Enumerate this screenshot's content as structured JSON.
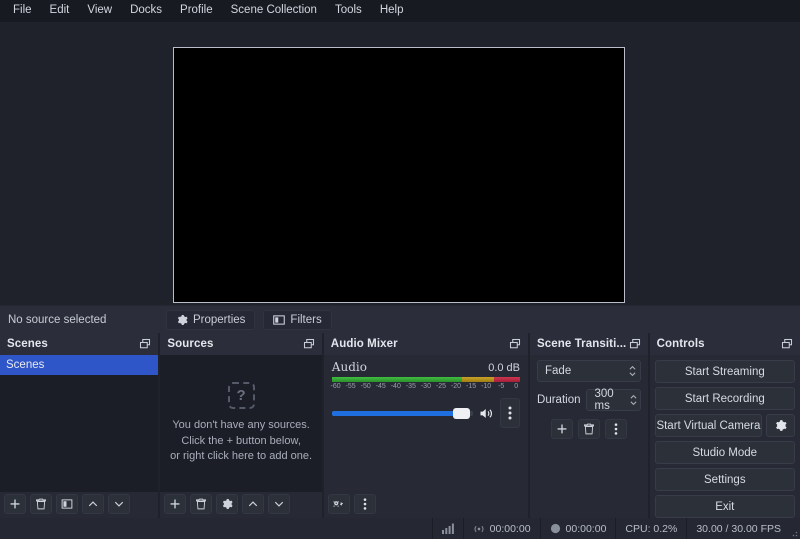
{
  "menu": {
    "items": [
      {
        "label": "File"
      },
      {
        "label": "Edit"
      },
      {
        "label": "View"
      },
      {
        "label": "Docks"
      },
      {
        "label": "Profile"
      },
      {
        "label": "Scene Collection"
      },
      {
        "label": "Tools"
      },
      {
        "label": "Help"
      }
    ]
  },
  "preview": {
    "canvas_color": "#000000",
    "border_color": "#b9bcc9"
  },
  "source_bar": {
    "no_source_label": "No source selected",
    "properties_label": "Properties",
    "filters_label": "Filters"
  },
  "scenes": {
    "title": "Scenes",
    "items": [
      {
        "label": "Scenes",
        "selected": true
      }
    ],
    "tools": [
      "add",
      "remove",
      "filters",
      "move-up",
      "move-down"
    ]
  },
  "sources": {
    "title": "Sources",
    "empty": {
      "line1": "You don't have any sources.",
      "line2": "Click the + button below,",
      "line3": "or right click here to add one.",
      "icon_glyph": "?"
    },
    "tools": [
      "add",
      "remove",
      "properties",
      "move-up",
      "move-down"
    ]
  },
  "audio_mixer": {
    "title": "Audio Mixer",
    "channel_name": "Audio",
    "level_label": "0.0 dB",
    "ticks": [
      "-60",
      "-55",
      "-50",
      "-45",
      "-40",
      "-35",
      "-30",
      "-25",
      "-20",
      "-15",
      "-10",
      "-5",
      "0"
    ],
    "volume_percent": 88,
    "muted": false,
    "colors": {
      "green": "#3fbf3f",
      "yellow": "#c9a227",
      "red": "#cf3550",
      "slider": "#1f6fe0"
    }
  },
  "scene_transitions": {
    "title": "Scene Transiti...",
    "transition_value": "Fade",
    "duration_label": "Duration",
    "duration_value": "300 ms"
  },
  "controls": {
    "title": "Controls",
    "buttons": [
      {
        "label": "Start Streaming"
      },
      {
        "label": "Start Recording"
      },
      {
        "label": "Start Virtual Camera"
      },
      {
        "label": "Studio Mode"
      },
      {
        "label": "Settings"
      },
      {
        "label": "Exit"
      }
    ]
  },
  "status_bar": {
    "stream_time": "00:00:00",
    "record_time": "00:00:00",
    "cpu": "CPU: 0.2%",
    "fps": "30.00 / 30.00 FPS"
  }
}
